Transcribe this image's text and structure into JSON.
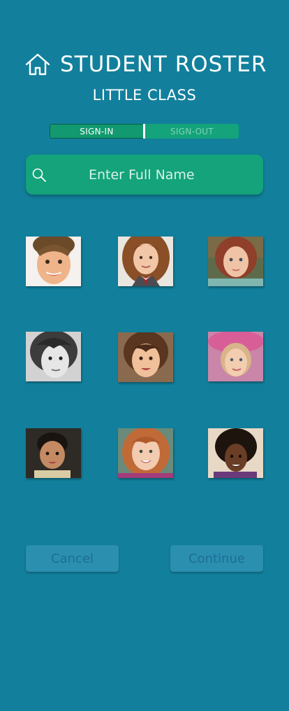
{
  "header": {
    "title": "STUDENT ROSTER",
    "icon": "home-icon"
  },
  "class_name": "LITTLE CLASS",
  "toggle": {
    "options": [
      "SIGN-IN",
      "SIGN-OUT"
    ],
    "selected": "SIGN-IN"
  },
  "search": {
    "placeholder": "Enter Full Name",
    "value": "",
    "icon": "search-icon"
  },
  "students": [
    {
      "photo": "student-photo-1"
    },
    {
      "photo": "student-photo-2"
    },
    {
      "photo": "student-photo-3"
    },
    {
      "photo": "student-photo-4"
    },
    {
      "photo": "student-photo-5"
    },
    {
      "photo": "student-photo-6"
    },
    {
      "photo": "student-photo-7"
    },
    {
      "photo": "student-photo-8"
    },
    {
      "photo": "student-photo-9"
    }
  ],
  "actions": {
    "cancel_label": "Cancel",
    "continue_label": "Continue"
  },
  "colors": {
    "background": "#12809c",
    "accent_green": "#14a37a",
    "button_bg": "#2b8fb0",
    "button_text": "#1e6d96"
  }
}
